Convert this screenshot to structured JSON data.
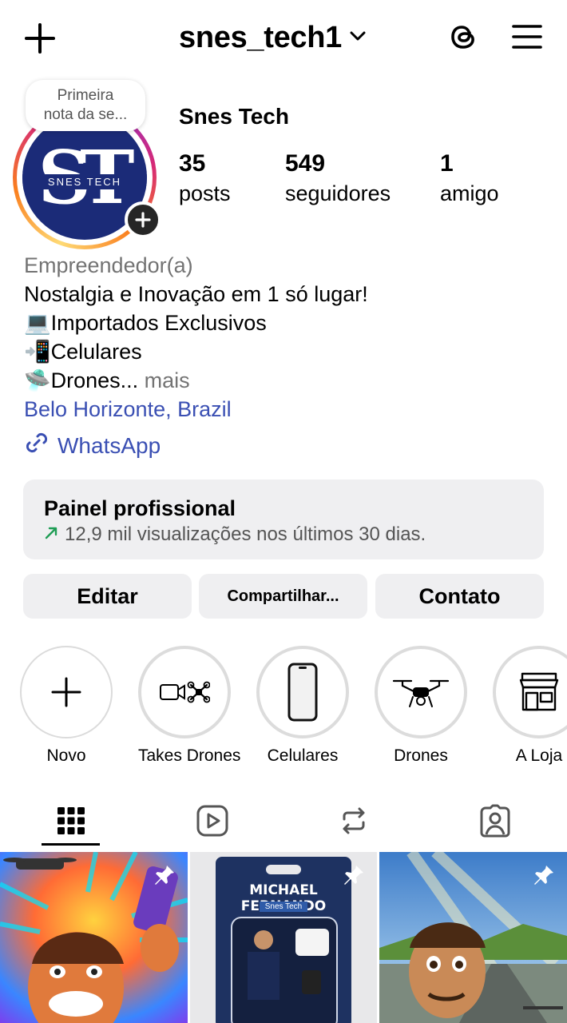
{
  "header": {
    "username": "snes_tech1",
    "icons": [
      "plus-icon",
      "chevron-down-icon",
      "threads-icon",
      "menu-icon"
    ]
  },
  "note": {
    "line1": "Primeira",
    "line2": "nota da se..."
  },
  "avatar": {
    "monogram": "ST",
    "brand": "SNES TECH"
  },
  "profile": {
    "display_name": "Snes Tech",
    "stats": [
      {
        "value": "35",
        "label": "posts"
      },
      {
        "value": "549",
        "label": "seguidores"
      },
      {
        "value": "1",
        "label": "amigo"
      }
    ]
  },
  "bio": {
    "category": "Empreendedor(a)",
    "line1": "Nostalgia e Inovação em 1 só lugar!",
    "line2": "💻Importados Exclusivos",
    "line3": "📲Celulares",
    "line4": "🛸Drones...",
    "more": " mais",
    "location": "Belo Horizonte, Brazil",
    "link": "WhatsApp"
  },
  "pro_panel": {
    "title": "Painel profissional",
    "subtitle": "12,9 mil visualizações nos últimos 30 dias."
  },
  "actions": {
    "edit": "Editar",
    "share": "Compartilhar...",
    "contact": "Contato"
  },
  "highlights": [
    {
      "label": "Novo",
      "icon": "plus-icon"
    },
    {
      "label": "Takes Drones",
      "icon": "camera-drone-icon"
    },
    {
      "label": "Celulares",
      "icon": "phone-icon"
    },
    {
      "label": "Drones",
      "icon": "drone-icon"
    },
    {
      "label": "A Loja",
      "icon": "store-icon"
    }
  ],
  "tabs": [
    "grid-icon",
    "reels-icon",
    "reposts-icon",
    "tagged-icon"
  ],
  "posts": [
    {
      "caption": ""
    },
    {
      "caption": "MICHAEL FERNANDO",
      "sub": "Snes Tech"
    },
    {
      "caption": ""
    }
  ],
  "colors": {
    "accent_link": "#3a4fb3",
    "avatar_bg": "#1b2b78",
    "panel_bg": "#efeff1",
    "trend_green": "#1f9d55"
  }
}
